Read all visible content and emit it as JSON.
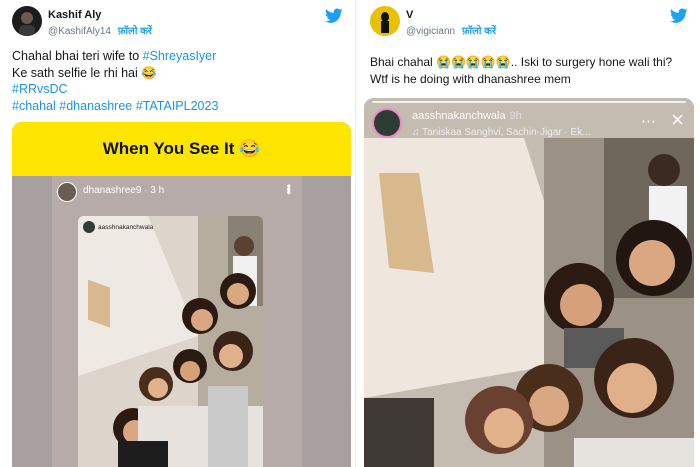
{
  "left_tweet": {
    "author_name": "Kashif Aly",
    "handle": "@KashifAly14",
    "follow_label": "फ़ॉलो करें",
    "text_line1": "Chahal  bhai teri wife to ",
    "mention": "#ShreyasIyer",
    "text_line2": "Ke sath selfie le rhi hai 😂",
    "hashtags_line1": "#RRvsDC",
    "hashtags_line2": "#chahal #dhanashree #TATAIPL2023",
    "banner_text": "When You See It 😂",
    "story_user": "dhanashree9",
    "story_time": "3 h",
    "inner_story_user": "aasshnakanchwala"
  },
  "right_tweet": {
    "author_name": "V",
    "handle": "@vigiciann",
    "follow_label": "फ़ॉलो करें",
    "text_line1": "Bhai chahal 😭😭😭😭😭.. Iski to surgery hone wali thi?",
    "text_line2": "Wtf is he doing with dhanashree mem",
    "story_user": "aasshnakanchwala",
    "story_time": "9h",
    "story_music": "Taniskaa Sanghvi, Sachin-Jigar · Ek...",
    "close_icon": "×",
    "more_icon": "⋯"
  },
  "colors": {
    "twitter_blue": "#1da1f2",
    "link_blue": "#1b95e0",
    "banner_yellow": "#fde500"
  }
}
